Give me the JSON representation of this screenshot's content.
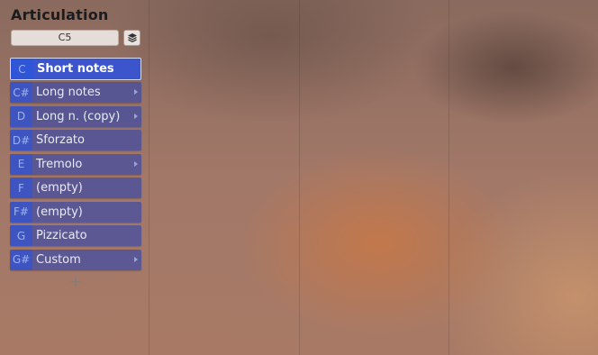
{
  "panel": {
    "title": "Articulation",
    "note_value": "C5",
    "stack_icon": "layers-icon",
    "add_icon": "plus-icon"
  },
  "colors": {
    "item_bg": "#3a48a8",
    "key_bg": "#3454d0",
    "selected_bg": "#3c55cc",
    "text": "#e9ebf6"
  },
  "items": [
    {
      "key": "C",
      "label": "Short notes",
      "selected": true,
      "has_submenu": false
    },
    {
      "key": "C#",
      "label": "Long notes",
      "selected": false,
      "has_submenu": true
    },
    {
      "key": "D",
      "label": "Long n. (copy)",
      "selected": false,
      "has_submenu": true
    },
    {
      "key": "D#",
      "label": "Sforzato",
      "selected": false,
      "has_submenu": false
    },
    {
      "key": "E",
      "label": "Tremolo",
      "selected": false,
      "has_submenu": true
    },
    {
      "key": "F",
      "label": "(empty)",
      "selected": false,
      "has_submenu": false
    },
    {
      "key": "F#",
      "label": "(empty)",
      "selected": false,
      "has_submenu": false
    },
    {
      "key": "G",
      "label": "Pizzicato",
      "selected": false,
      "has_submenu": false
    },
    {
      "key": "G#",
      "label": "Custom",
      "selected": false,
      "has_submenu": true
    }
  ],
  "add_label": "+"
}
